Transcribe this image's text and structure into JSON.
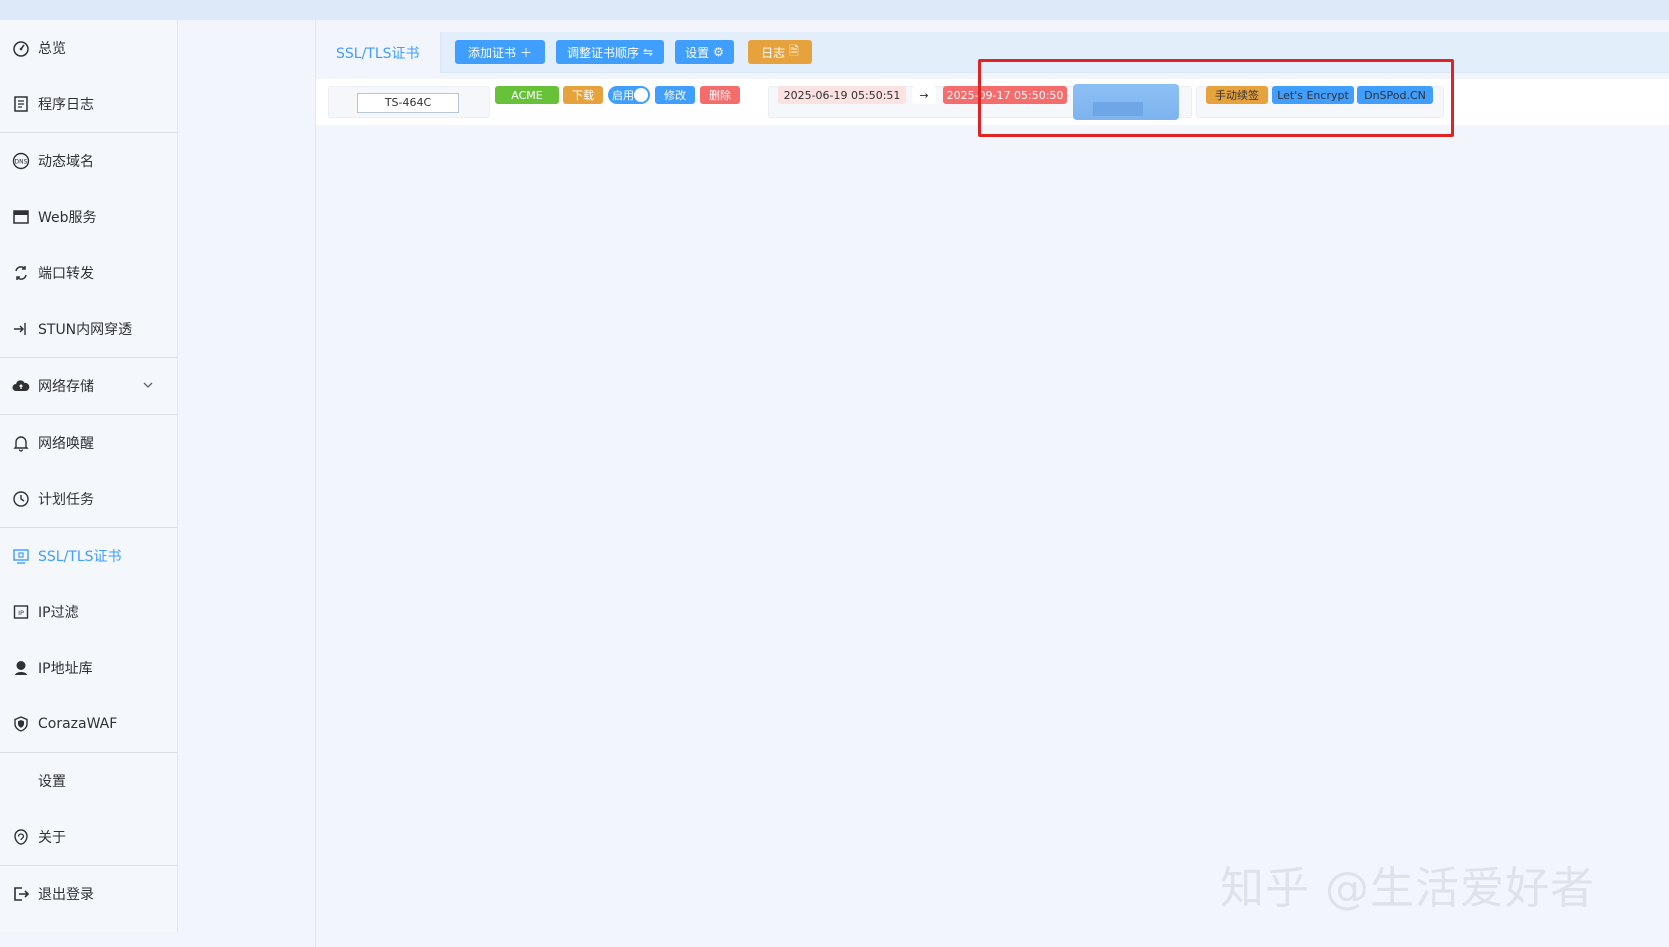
{
  "sidebar": {
    "items": [
      {
        "label": "总览",
        "icon": "dashboard-icon"
      },
      {
        "label": "程序日志",
        "icon": "log-icon"
      },
      {
        "label": "动态域名",
        "icon": "dns-icon"
      },
      {
        "label": "Web服务",
        "icon": "web-icon"
      },
      {
        "label": "端口转发",
        "icon": "port-forward-icon"
      },
      {
        "label": "STUN内网穿透",
        "icon": "stun-icon"
      },
      {
        "label": "网络存储",
        "icon": "cloud-icon"
      },
      {
        "label": "网络唤醒",
        "icon": "bell-icon"
      },
      {
        "label": "计划任务",
        "icon": "clock-icon"
      },
      {
        "label": "SSL/TLS证书",
        "icon": "certificate-icon"
      },
      {
        "label": "IP过滤",
        "icon": "ip-filter-icon"
      },
      {
        "label": "IP地址库",
        "icon": "ip-db-icon"
      },
      {
        "label": "CorazaWAF",
        "icon": "shield-icon"
      },
      {
        "label": "设置",
        "icon": ""
      },
      {
        "label": "关于",
        "icon": "about-icon"
      },
      {
        "label": "退出登录",
        "icon": "logout-icon"
      }
    ]
  },
  "tabs": {
    "active_label": "SSL/TLS证书",
    "add_cert": "添加证书",
    "reorder": "调整证书顺序",
    "settings": "设置",
    "log": "日志"
  },
  "cert_row": {
    "name": "TS-464C",
    "type_tag": "ACME",
    "download": "下载",
    "enable": "启用",
    "edit": "修改",
    "delete": "删除",
    "valid_from": "2025-06-19 05:50:51",
    "arrow": "→",
    "valid_to": "2025-09-17 05:50:50",
    "renew": "手动续签",
    "issuer": "Let's Encrypt",
    "dns_provider": "DnSPod.CN"
  },
  "watermark": "知乎 @生活爱好者",
  "colors": {
    "primary": "#409eff",
    "success": "#67c23a",
    "warning": "#e6a23c",
    "danger": "#f56c6c",
    "highlight": "#e02424"
  }
}
